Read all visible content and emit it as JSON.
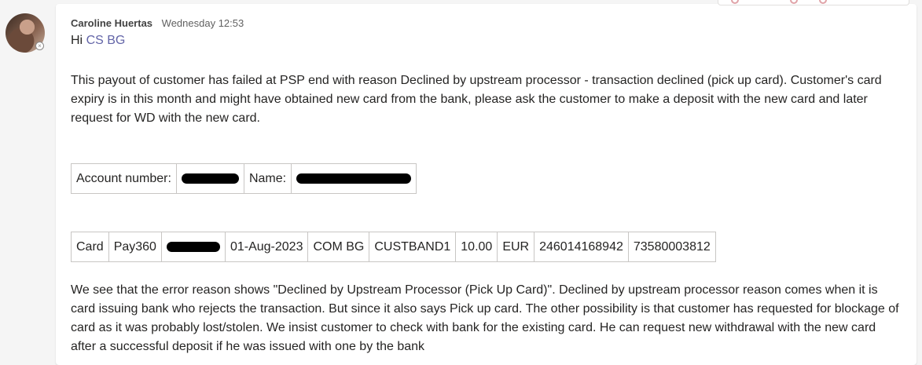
{
  "message": {
    "author": "Caroline Huertas",
    "timestamp": "Wednesday 12:53",
    "greeting_prefix": "Hi ",
    "mention": "CS BG",
    "paragraph1": "This payout of customer has failed at PSP end with reason Declined by upstream processor - transaction declined (pick up card). Customer's card expiry is in this month and might have obtained new card from the bank, please ask the customer to make a deposit with the new card and later request for WD with the new card.",
    "account_table": {
      "account_label": "Account number:",
      "name_label": "Name:"
    },
    "card_table": {
      "cells": [
        "Card",
        "Pay360",
        "",
        "01-Aug-2023",
        "COM BG",
        "CUSTBAND1",
        "10.00",
        "EUR",
        "246014168942",
        "73580003812"
      ]
    },
    "paragraph2": "We see that the error reason shows \"Declined by Upstream Processor (Pick Up Card)\". Declined by upstream processor reason comes when it is card issuing bank who rejects the transaction. But since it also says Pick up card. The other possibility is that customer has requested for blockage of card as it was probably lost/stolen. We insist customer to check with bank for the existing card. He can request new withdrawal with the new card after a successful deposit if he was issued with one by the bank"
  },
  "colors": {
    "mention": "#6264a7",
    "background": "#f5f5f5",
    "card": "#ffffff"
  }
}
